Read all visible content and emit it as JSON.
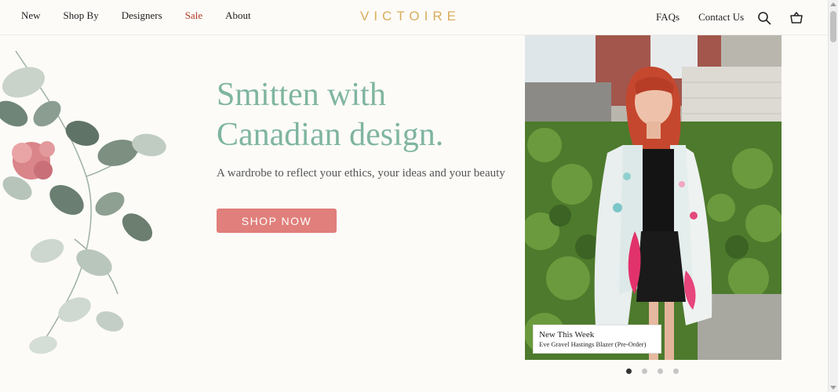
{
  "header": {
    "nav_left": [
      {
        "label": "New"
      },
      {
        "label": "Shop By"
      },
      {
        "label": "Designers"
      },
      {
        "label": "Sale"
      },
      {
        "label": "About"
      }
    ],
    "logo": "VICTOIRE",
    "nav_right": [
      {
        "label": "FAQs"
      },
      {
        "label": "Contact Us"
      }
    ],
    "icons": [
      "search-icon",
      "basket-icon"
    ]
  },
  "hero": {
    "headline_line1": "Smitten with",
    "headline_line2": "Canadian design.",
    "subline": "A wardrobe to reflect your ethics, your ideas and your beauty",
    "cta_label": "SHOP NOW"
  },
  "slideshow": {
    "caption_title": "New This Week",
    "caption_subtitle": "Eve Gravel Hastings Blazer (Pre-Order)",
    "slide_count": 4,
    "active_slide": 1
  },
  "colors": {
    "accent_green": "#7fb5a0",
    "logo_gold": "#d9ad5c",
    "cta_pink": "#e07f7b",
    "sale_red": "#b23a23",
    "background": "#fcfbf8"
  }
}
